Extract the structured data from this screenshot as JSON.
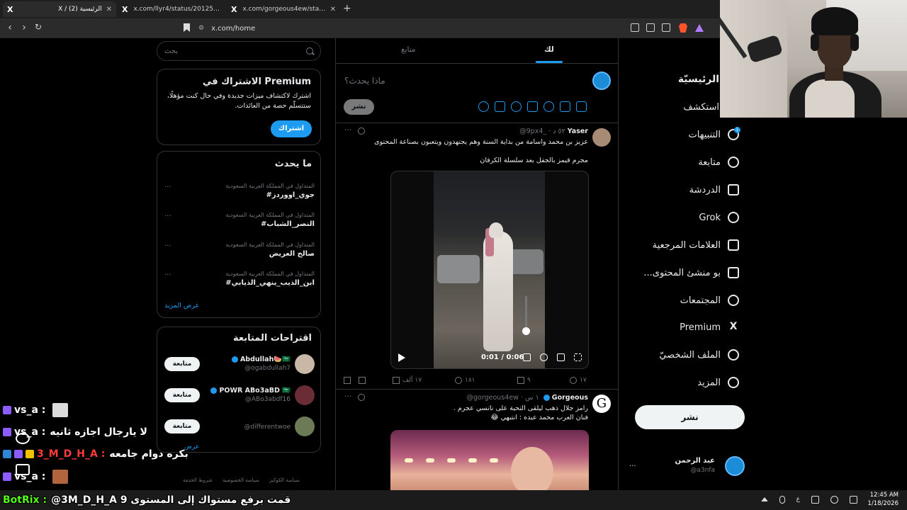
{
  "browser": {
    "tabs": [
      {
        "title": "X / (2) الرئيسية",
        "active": true
      },
      {
        "title": "x.com/llyr4/status/2012594646879...",
        "active": false
      },
      {
        "title": "x.com/gorgeous4ew/status/20126...",
        "active": false
      }
    ],
    "url": "x.com/home"
  },
  "search": {
    "placeholder": "بحث"
  },
  "premium": {
    "title": "الاشتراك في Premium",
    "desc": "اشترك لاكتشاف ميزات جديدة وفي حال كنت مؤهلًا، ستتسلّم حصة من العائدات.",
    "button": "اشتراك"
  },
  "trends": {
    "title": "ما يحدث",
    "items": [
      {
        "meta": "المتداول في المملكة العربية السعودية",
        "name": "#جوي_اووردز"
      },
      {
        "meta": "المتداول في المملكة العربية السعودية",
        "name": "#النصر_الشباب"
      },
      {
        "meta": "المتداول في المملكة العربية السعودية",
        "name": "صالح العريض"
      },
      {
        "meta": "المتداول في المملكة العربية السعودية",
        "name": "#ابن_الذيب_ينهي_الذيابي"
      }
    ],
    "more_icon": "...",
    "show_more": "عرض المزيد"
  },
  "follow": {
    "title": "اقتراحات المتابعة",
    "items": [
      {
        "name": "Abdullah🍉🇸🇦",
        "handle": "@ogabdullah7",
        "button": "متابعة",
        "verified": true,
        "color": "#c9b8a6"
      },
      {
        "name": "POWR ABo3aBD 🇸🇦",
        "handle": "@ABo3abdf16",
        "button": "متابعة",
        "verified": true,
        "color": "#6a2d36"
      },
      {
        "name": "",
        "handle": "@differentwoe",
        "button": "متابعة",
        "verified": false,
        "color": "#6c7a55"
      }
    ],
    "show_more": "عرض"
  },
  "footer": [
    "شروط الخدمة",
    "سياسة الخصوصية",
    "سياسة الكوكيز"
  ],
  "feed": {
    "tabs": {
      "for_you": "لك",
      "following": "متابع"
    },
    "composer": {
      "prompt": "ماذا يحدث؟",
      "post": "نشر"
    },
    "tweets": [
      {
        "author": "Yaser",
        "meta": "@9px4_ · ٥٢ د",
        "text1": "عزيز بن محمد واسامة من بداية السنة وهم يجتهدون ويتعبون بصناعة المحتوى",
        "text2": "مجرم قيمز بالجفل بعد سلسلة الكرفان",
        "video_time": "0:01 / 0:06",
        "replies": "١٧",
        "retweets": "٩",
        "likes": "١٨١",
        "views": "١٧ ألف"
      },
      {
        "author": "Gorgeous",
        "meta": "@gorgeous4ew · ١ س",
        "avatar_letter": "G",
        "text1": "رامز جلال ذهب ليلقى التحية على نانسي عجرم .",
        "text2": "فنان العرب محمد عبده : انتبهي 😂"
      }
    ]
  },
  "nav": {
    "items": [
      {
        "label": "الرئيسيّة",
        "icon": "home-icon"
      },
      {
        "label": "استكشف",
        "icon": "explore-icon"
      },
      {
        "label": "التنبيهات",
        "icon": "bell-icon",
        "badge": "1"
      },
      {
        "label": "متابعة",
        "icon": "add-user-icon"
      },
      {
        "label": "الدردشة",
        "icon": "mail-icon"
      },
      {
        "label": "Grok",
        "icon": "grok-icon"
      },
      {
        "label": "العلامات المرجعية",
        "icon": "bookmark-icon"
      },
      {
        "label": "...بو منشئ المحتوى",
        "icon": "creator-icon"
      },
      {
        "label": "المجتمعات",
        "icon": "communities-icon"
      },
      {
        "label": "Premium",
        "icon": "x-logo-icon"
      },
      {
        "label": "الملف الشخصيّ",
        "icon": "profile-icon"
      },
      {
        "label": "المزيد",
        "icon": "more-icon"
      }
    ],
    "post": "نشر",
    "profile": {
      "name": "عبد الرحمن",
      "handle": "@a3nfa",
      "more": "..."
    }
  },
  "chat": {
    "lines": [
      {
        "user": "vs_a :",
        "msg": "",
        "user_color": "#ffffff",
        "emote_color": "#dcdcdc"
      },
      {
        "user": "vs_a :",
        "msg": "لا يارجال اجازه ثانيه",
        "user_color": "#ffffff",
        "emote_color": ""
      },
      {
        "user": "3_M_D_H_A :",
        "msg": "بكره دوام جامعه",
        "user_color": "#ff3b3b",
        "emote_color": ""
      },
      {
        "user": "vs_a :",
        "msg": "",
        "user_color": "#ffffff",
        "emote_color": "#b0653f"
      }
    ],
    "botrix": {
      "name": "BotRix :",
      "msg": "@3M_D_H_A قمت برفع مستواك إلى المستوى 9"
    }
  },
  "taskbar": {
    "lang": "ع",
    "time": "12:45 AM",
    "date": "1/18/2026"
  },
  "colors": {
    "accent": "#1d9bf0",
    "bg": "#000000",
    "border": "#2f3336",
    "muted": "#71767b",
    "botrix": "#53fc18"
  }
}
